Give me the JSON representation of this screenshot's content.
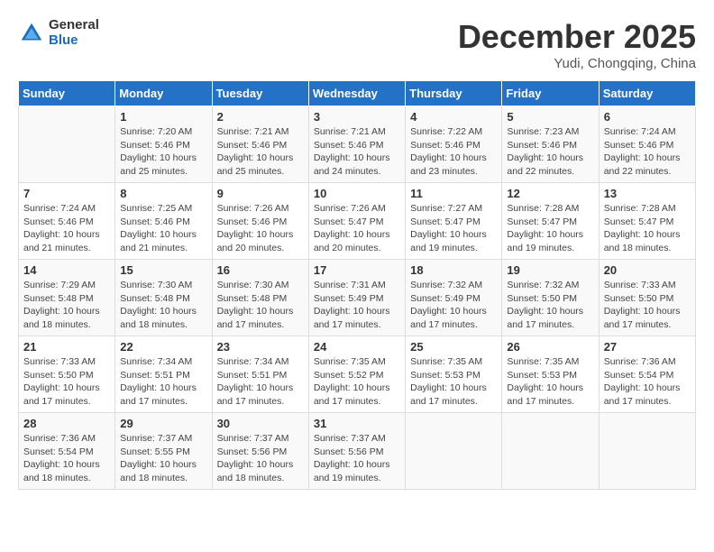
{
  "header": {
    "logo_general": "General",
    "logo_blue": "Blue",
    "month": "December 2025",
    "location": "Yudi, Chongqing, China"
  },
  "days_of_week": [
    "Sunday",
    "Monday",
    "Tuesday",
    "Wednesday",
    "Thursday",
    "Friday",
    "Saturday"
  ],
  "weeks": [
    [
      {
        "day": "",
        "content": ""
      },
      {
        "day": "1",
        "content": "Sunrise: 7:20 AM\nSunset: 5:46 PM\nDaylight: 10 hours\nand 25 minutes."
      },
      {
        "day": "2",
        "content": "Sunrise: 7:21 AM\nSunset: 5:46 PM\nDaylight: 10 hours\nand 25 minutes."
      },
      {
        "day": "3",
        "content": "Sunrise: 7:21 AM\nSunset: 5:46 PM\nDaylight: 10 hours\nand 24 minutes."
      },
      {
        "day": "4",
        "content": "Sunrise: 7:22 AM\nSunset: 5:46 PM\nDaylight: 10 hours\nand 23 minutes."
      },
      {
        "day": "5",
        "content": "Sunrise: 7:23 AM\nSunset: 5:46 PM\nDaylight: 10 hours\nand 22 minutes."
      },
      {
        "day": "6",
        "content": "Sunrise: 7:24 AM\nSunset: 5:46 PM\nDaylight: 10 hours\nand 22 minutes."
      }
    ],
    [
      {
        "day": "7",
        "content": "Sunrise: 7:24 AM\nSunset: 5:46 PM\nDaylight: 10 hours\nand 21 minutes."
      },
      {
        "day": "8",
        "content": "Sunrise: 7:25 AM\nSunset: 5:46 PM\nDaylight: 10 hours\nand 21 minutes."
      },
      {
        "day": "9",
        "content": "Sunrise: 7:26 AM\nSunset: 5:46 PM\nDaylight: 10 hours\nand 20 minutes."
      },
      {
        "day": "10",
        "content": "Sunrise: 7:26 AM\nSunset: 5:47 PM\nDaylight: 10 hours\nand 20 minutes."
      },
      {
        "day": "11",
        "content": "Sunrise: 7:27 AM\nSunset: 5:47 PM\nDaylight: 10 hours\nand 19 minutes."
      },
      {
        "day": "12",
        "content": "Sunrise: 7:28 AM\nSunset: 5:47 PM\nDaylight: 10 hours\nand 19 minutes."
      },
      {
        "day": "13",
        "content": "Sunrise: 7:28 AM\nSunset: 5:47 PM\nDaylight: 10 hours\nand 18 minutes."
      }
    ],
    [
      {
        "day": "14",
        "content": "Sunrise: 7:29 AM\nSunset: 5:48 PM\nDaylight: 10 hours\nand 18 minutes."
      },
      {
        "day": "15",
        "content": "Sunrise: 7:30 AM\nSunset: 5:48 PM\nDaylight: 10 hours\nand 18 minutes."
      },
      {
        "day": "16",
        "content": "Sunrise: 7:30 AM\nSunset: 5:48 PM\nDaylight: 10 hours\nand 17 minutes."
      },
      {
        "day": "17",
        "content": "Sunrise: 7:31 AM\nSunset: 5:49 PM\nDaylight: 10 hours\nand 17 minutes."
      },
      {
        "day": "18",
        "content": "Sunrise: 7:32 AM\nSunset: 5:49 PM\nDaylight: 10 hours\nand 17 minutes."
      },
      {
        "day": "19",
        "content": "Sunrise: 7:32 AM\nSunset: 5:50 PM\nDaylight: 10 hours\nand 17 minutes."
      },
      {
        "day": "20",
        "content": "Sunrise: 7:33 AM\nSunset: 5:50 PM\nDaylight: 10 hours\nand 17 minutes."
      }
    ],
    [
      {
        "day": "21",
        "content": "Sunrise: 7:33 AM\nSunset: 5:50 PM\nDaylight: 10 hours\nand 17 minutes."
      },
      {
        "day": "22",
        "content": "Sunrise: 7:34 AM\nSunset: 5:51 PM\nDaylight: 10 hours\nand 17 minutes."
      },
      {
        "day": "23",
        "content": "Sunrise: 7:34 AM\nSunset: 5:51 PM\nDaylight: 10 hours\nand 17 minutes."
      },
      {
        "day": "24",
        "content": "Sunrise: 7:35 AM\nSunset: 5:52 PM\nDaylight: 10 hours\nand 17 minutes."
      },
      {
        "day": "25",
        "content": "Sunrise: 7:35 AM\nSunset: 5:53 PM\nDaylight: 10 hours\nand 17 minutes."
      },
      {
        "day": "26",
        "content": "Sunrise: 7:35 AM\nSunset: 5:53 PM\nDaylight: 10 hours\nand 17 minutes."
      },
      {
        "day": "27",
        "content": "Sunrise: 7:36 AM\nSunset: 5:54 PM\nDaylight: 10 hours\nand 17 minutes."
      }
    ],
    [
      {
        "day": "28",
        "content": "Sunrise: 7:36 AM\nSunset: 5:54 PM\nDaylight: 10 hours\nand 18 minutes."
      },
      {
        "day": "29",
        "content": "Sunrise: 7:37 AM\nSunset: 5:55 PM\nDaylight: 10 hours\nand 18 minutes."
      },
      {
        "day": "30",
        "content": "Sunrise: 7:37 AM\nSunset: 5:56 PM\nDaylight: 10 hours\nand 18 minutes."
      },
      {
        "day": "31",
        "content": "Sunrise: 7:37 AM\nSunset: 5:56 PM\nDaylight: 10 hours\nand 19 minutes."
      },
      {
        "day": "",
        "content": ""
      },
      {
        "day": "",
        "content": ""
      },
      {
        "day": "",
        "content": ""
      }
    ]
  ]
}
